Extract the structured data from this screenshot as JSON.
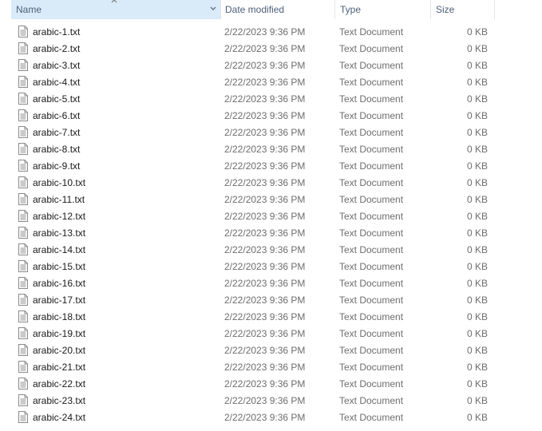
{
  "columns": {
    "name": "Name",
    "date": "Date modified",
    "type": "Type",
    "size": "Size"
  },
  "icons": {
    "sort": "sort-up-caret-icon",
    "column_menu": "chevron-down-icon",
    "file": "text-file-icon"
  },
  "colors": {
    "header_selected": "#d9ebf9",
    "header_text": "#4c607a",
    "secondary_text": "#6d6d6d"
  },
  "files": [
    {
      "name": "arabic-1.txt",
      "date": "2/22/2023 9:36 PM",
      "type": "Text Document",
      "size": "0 KB"
    },
    {
      "name": "arabic-2.txt",
      "date": "2/22/2023 9:36 PM",
      "type": "Text Document",
      "size": "0 KB"
    },
    {
      "name": "arabic-3.txt",
      "date": "2/22/2023 9:36 PM",
      "type": "Text Document",
      "size": "0 KB"
    },
    {
      "name": "arabic-4.txt",
      "date": "2/22/2023 9:36 PM",
      "type": "Text Document",
      "size": "0 KB"
    },
    {
      "name": "arabic-5.txt",
      "date": "2/22/2023 9:36 PM",
      "type": "Text Document",
      "size": "0 KB"
    },
    {
      "name": "arabic-6.txt",
      "date": "2/22/2023 9:36 PM",
      "type": "Text Document",
      "size": "0 KB"
    },
    {
      "name": "arabic-7.txt",
      "date": "2/22/2023 9:36 PM",
      "type": "Text Document",
      "size": "0 KB"
    },
    {
      "name": "arabic-8.txt",
      "date": "2/22/2023 9:36 PM",
      "type": "Text Document",
      "size": "0 KB"
    },
    {
      "name": "arabic-9.txt",
      "date": "2/22/2023 9:36 PM",
      "type": "Text Document",
      "size": "0 KB"
    },
    {
      "name": "arabic-10.txt",
      "date": "2/22/2023 9:36 PM",
      "type": "Text Document",
      "size": "0 KB"
    },
    {
      "name": "arabic-11.txt",
      "date": "2/22/2023 9:36 PM",
      "type": "Text Document",
      "size": "0 KB"
    },
    {
      "name": "arabic-12.txt",
      "date": "2/22/2023 9:36 PM",
      "type": "Text Document",
      "size": "0 KB"
    },
    {
      "name": "arabic-13.txt",
      "date": "2/22/2023 9:36 PM",
      "type": "Text Document",
      "size": "0 KB"
    },
    {
      "name": "arabic-14.txt",
      "date": "2/22/2023 9:36 PM",
      "type": "Text Document",
      "size": "0 KB"
    },
    {
      "name": "arabic-15.txt",
      "date": "2/22/2023 9:36 PM",
      "type": "Text Document",
      "size": "0 KB"
    },
    {
      "name": "arabic-16.txt",
      "date": "2/22/2023 9:36 PM",
      "type": "Text Document",
      "size": "0 KB"
    },
    {
      "name": "arabic-17.txt",
      "date": "2/22/2023 9:36 PM",
      "type": "Text Document",
      "size": "0 KB"
    },
    {
      "name": "arabic-18.txt",
      "date": "2/22/2023 9:36 PM",
      "type": "Text Document",
      "size": "0 KB"
    },
    {
      "name": "arabic-19.txt",
      "date": "2/22/2023 9:36 PM",
      "type": "Text Document",
      "size": "0 KB"
    },
    {
      "name": "arabic-20.txt",
      "date": "2/22/2023 9:36 PM",
      "type": "Text Document",
      "size": "0 KB"
    },
    {
      "name": "arabic-21.txt",
      "date": "2/22/2023 9:36 PM",
      "type": "Text Document",
      "size": "0 KB"
    },
    {
      "name": "arabic-22.txt",
      "date": "2/22/2023 9:36 PM",
      "type": "Text Document",
      "size": "0 KB"
    },
    {
      "name": "arabic-23.txt",
      "date": "2/22/2023 9:36 PM",
      "type": "Text Document",
      "size": "0 KB"
    },
    {
      "name": "arabic-24.txt",
      "date": "2/22/2023 9:36 PM",
      "type": "Text Document",
      "size": "0 KB"
    }
  ]
}
